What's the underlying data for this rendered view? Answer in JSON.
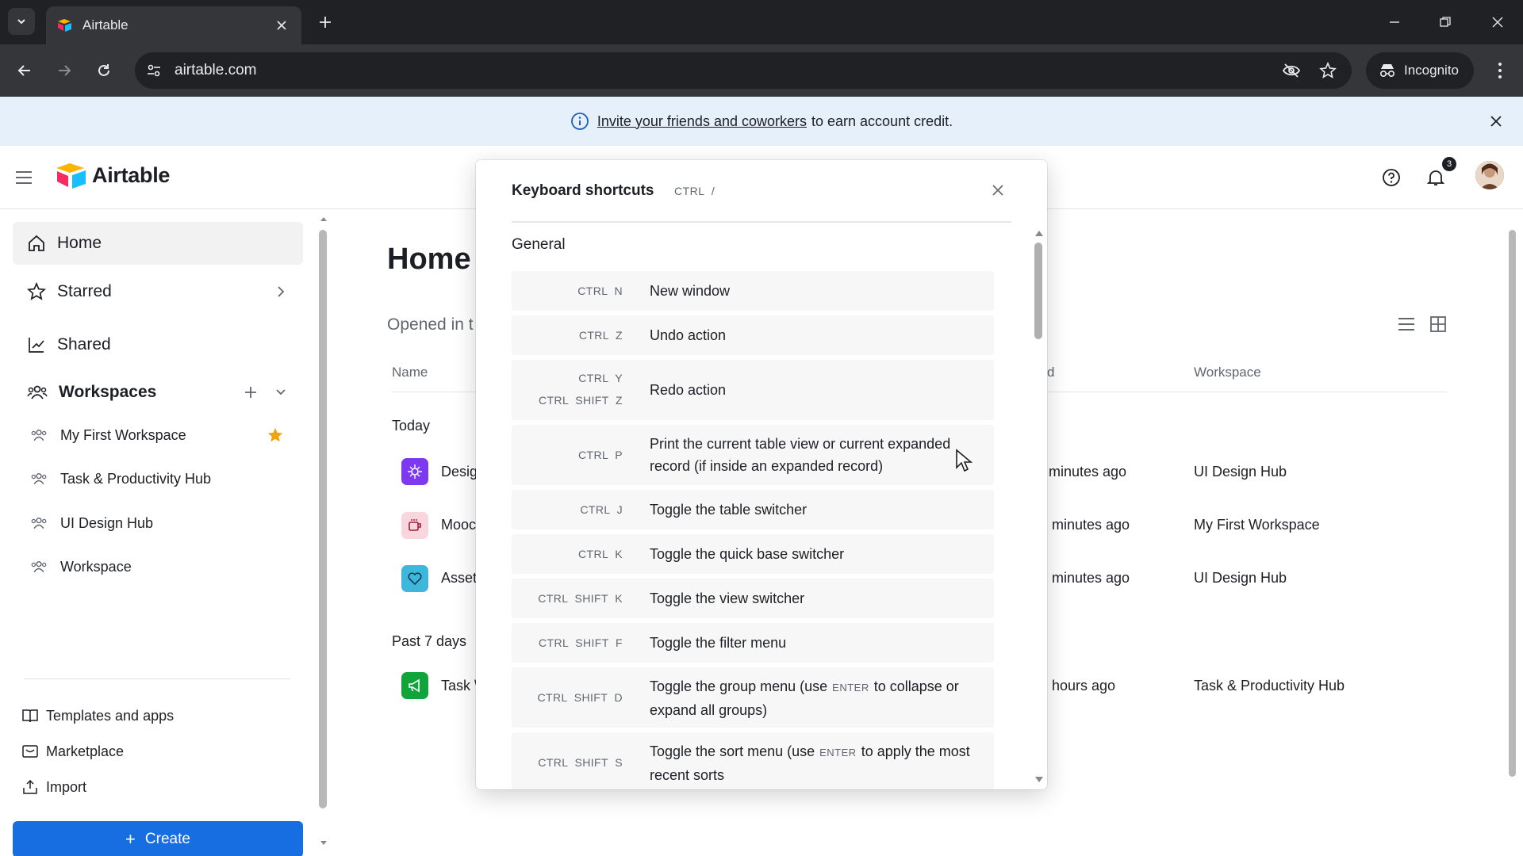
{
  "browser": {
    "tab_title": "Airtable",
    "url": "airtable.com",
    "incognito_label": "Incognito"
  },
  "banner": {
    "link_text": "Invite your friends and coworkers",
    "rest_text": "to earn account credit."
  },
  "app": {
    "logo_text": "Airtable",
    "notification_count": "3"
  },
  "sidebar": {
    "home": "Home",
    "starred": "Starred",
    "shared": "Shared",
    "workspaces": "Workspaces",
    "workspace_items": [
      "My First Workspace",
      "Task & Productivity Hub",
      "UI Design Hub",
      "Workspace"
    ],
    "templates": "Templates and apps",
    "marketplace": "Marketplace",
    "import": "Import",
    "create": "Create"
  },
  "main": {
    "title": "Home",
    "opened_label": "Opened in t",
    "col_name": "Name",
    "col_opened": "d",
    "col_workspace": "Workspace",
    "group_today": "Today",
    "group_past": "Past 7 days",
    "rows": [
      {
        "name": "Desig",
        "time": "minutes ago",
        "workspace": "UI Design Hub"
      },
      {
        "name": "Mooc",
        "time": "minutes ago",
        "workspace": "My First Workspace"
      },
      {
        "name": "Asset",
        "time": "minutes ago",
        "workspace": "UI Design Hub"
      },
      {
        "name": "Task \\",
        "time": "hours ago",
        "workspace": "Task & Productivity Hub"
      }
    ]
  },
  "modal": {
    "title": "Keyboard shortcuts",
    "hint": "CTRL  /",
    "section": "General",
    "shortcuts": [
      {
        "keys": [
          "CTRL  N"
        ],
        "desc": "New window"
      },
      {
        "keys": [
          "CTRL  Z"
        ],
        "desc": "Undo action"
      },
      {
        "keys": [
          "CTRL  Y",
          "CTRL  SHIFT  Z"
        ],
        "desc": "Redo action"
      },
      {
        "keys": [
          "CTRL  P"
        ],
        "desc": "Print the current table view or current expanded record (if inside an expanded record)"
      },
      {
        "keys": [
          "CTRL  J"
        ],
        "desc": "Toggle the table switcher"
      },
      {
        "keys": [
          "CTRL  K"
        ],
        "desc": "Toggle the quick base switcher"
      },
      {
        "keys": [
          "CTRL  SHIFT  K"
        ],
        "desc": "Toggle the view switcher"
      },
      {
        "keys": [
          "CTRL  SHIFT  F"
        ],
        "desc": "Toggle the filter menu"
      },
      {
        "keys": [
          "CTRL  SHIFT  D"
        ],
        "desc_a": "Toggle the group menu (use",
        "inline_key": "ENTER",
        "desc_b": "to collapse or expand all groups)"
      },
      {
        "keys": [
          "CTRL  SHIFT  S"
        ],
        "desc_a": "Toggle the sort menu (use",
        "inline_key": "ENTER",
        "desc_b": "to apply the most recent sorts"
      }
    ]
  },
  "colors": {
    "brand_blue": "#166ee1",
    "banner_bg": "#e6f0fb",
    "chrome_dark": "#202124",
    "chrome_mid": "#35363a"
  }
}
